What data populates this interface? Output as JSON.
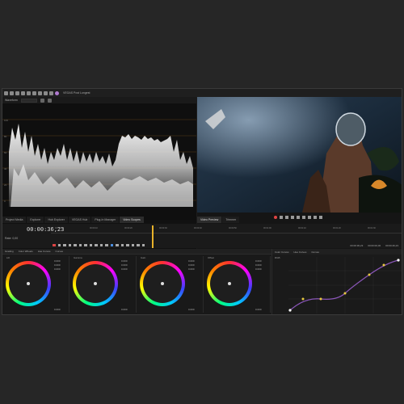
{
  "app": {
    "title": "VEGAS Pro",
    "project_name": "VEGAS Post Longest"
  },
  "scopes": {
    "header_label": "Waveform",
    "mode": "Luma"
  },
  "tabs_left": [
    {
      "label": "Project Media"
    },
    {
      "label": "Explorer"
    },
    {
      "label": "Hub Explorer"
    },
    {
      "label": "VEGAS Hub"
    },
    {
      "label": "Plug-In Manager"
    },
    {
      "label": "Video Scopes"
    }
  ],
  "tabs_right": [
    {
      "label": "Video Preview"
    },
    {
      "label": "Trimmer"
    }
  ],
  "timeline": {
    "timecode": "00:00:36,23",
    "rate_label": "Rate: 0,00",
    "ruler_ticks": [
      "00:00:00",
      "00:00:10",
      "00:00:20",
      "00:00:30",
      "00:00:40",
      "00:00:50",
      "00:01:00",
      "00:01:10",
      "00:01:20",
      "00:01:30"
    ],
    "right_times": [
      "00:00:36,23",
      "00:00:00,00",
      "00:00:46,23"
    ]
  },
  "grading": {
    "header": [
      "Grading",
      "Color Wheels",
      "Hue Curves",
      "Curves"
    ],
    "wheels": [
      {
        "label": "Lift",
        "r": "0.000",
        "g": "0.000",
        "b": "0.000",
        "foot": "0.000"
      },
      {
        "label": "Gamma",
        "r": "0.000",
        "g": "0.000",
        "b": "0.000",
        "foot": "0.000"
      },
      {
        "label": "Gain",
        "r": "0.000",
        "g": "0.000",
        "b": "0.000",
        "foot": "0.000"
      },
      {
        "label": "Offset",
        "r": "0.000",
        "g": "0.000",
        "b": "0.000",
        "foot": "0.000"
      }
    ],
    "curves_header": [
      "Color Curves",
      "Hue Curves",
      "Curves"
    ],
    "curves_label": "RGB"
  },
  "colors": {
    "playhead": "#e8b22a",
    "curve_line": "#8a56b8",
    "curve_points": "#e8c840",
    "selection": "#4c8fe0"
  }
}
